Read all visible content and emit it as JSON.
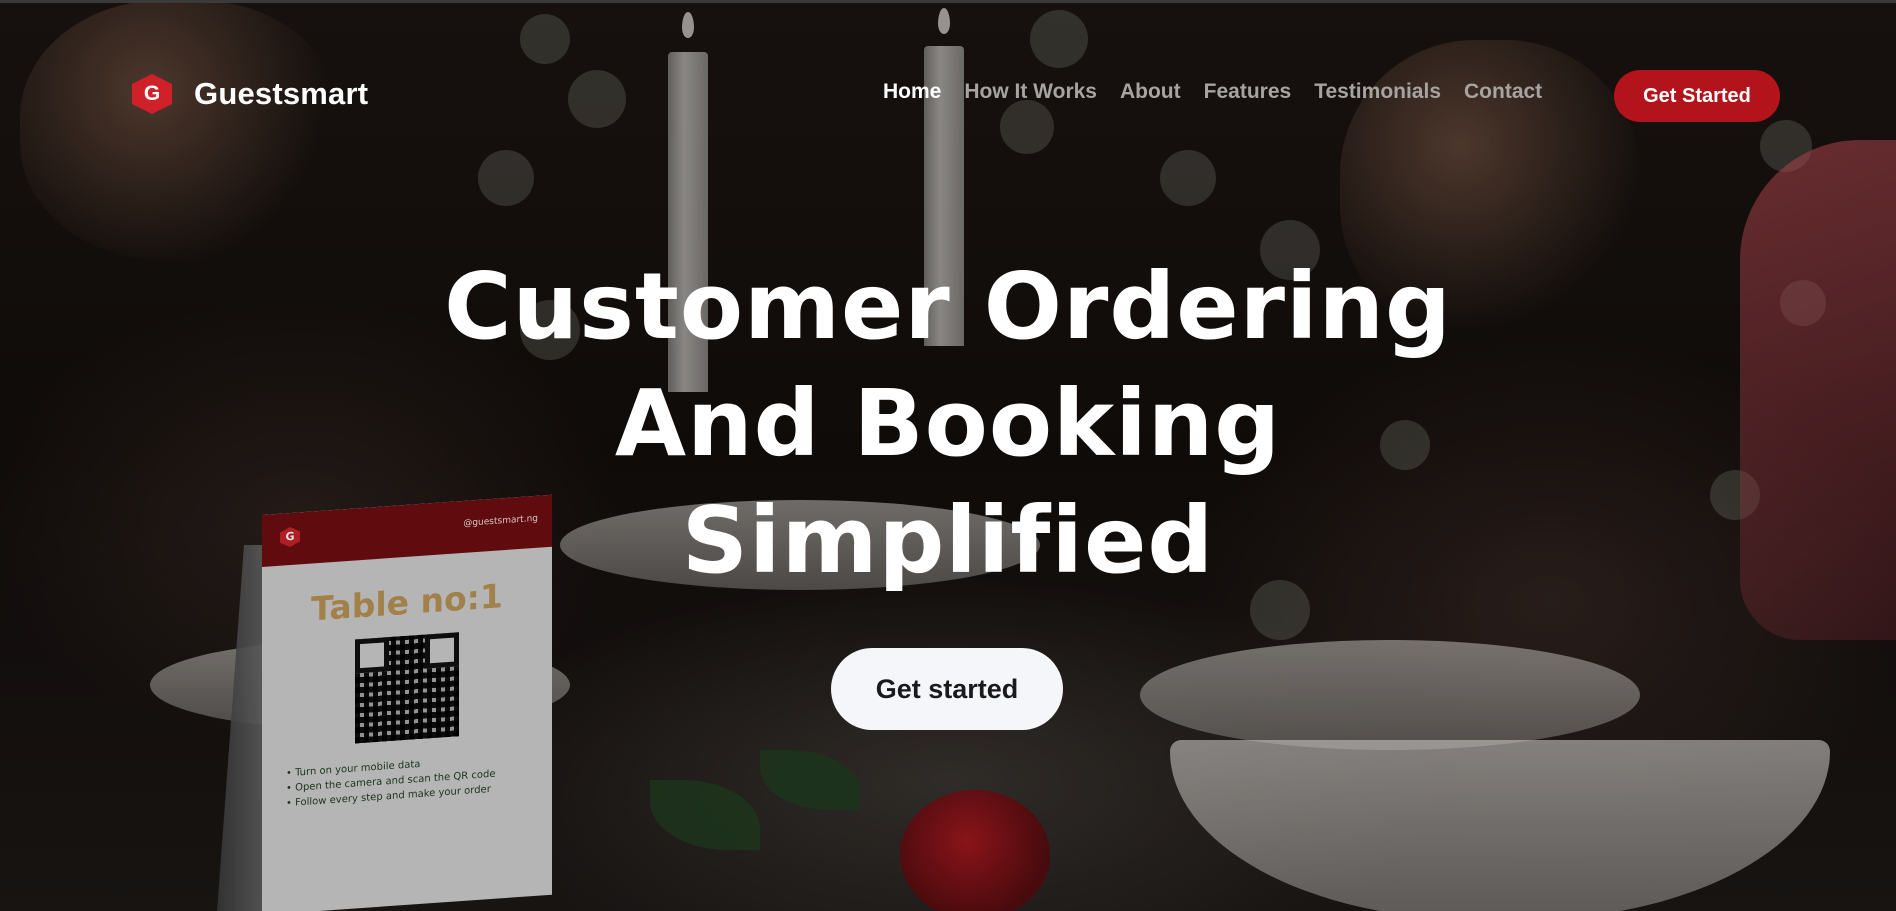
{
  "brand": {
    "name": "Guestsmart",
    "logo_letter": "G",
    "color": "#d0212a"
  },
  "nav": {
    "items": [
      {
        "label": "Home",
        "active": true
      },
      {
        "label": "How It Works",
        "active": false
      },
      {
        "label": "About",
        "active": false
      },
      {
        "label": "Features",
        "active": false
      },
      {
        "label": "Testimonials",
        "active": false
      },
      {
        "label": "Contact",
        "active": false
      }
    ],
    "cta_label": "Get Started",
    "cta_color": "#b3131a"
  },
  "hero": {
    "headline_line1": "Customer Ordering",
    "headline_line2": "And Booking",
    "headline_line3": "Simplified",
    "cta_label": "Get started"
  },
  "table_card": {
    "logo_letter": "G",
    "handle": "@guestsmart.ng",
    "table_label": "Table no:1",
    "steps": [
      "Turn on your mobile data",
      "Open the camera and scan the QR code",
      "Follow every step and make your order"
    ]
  }
}
